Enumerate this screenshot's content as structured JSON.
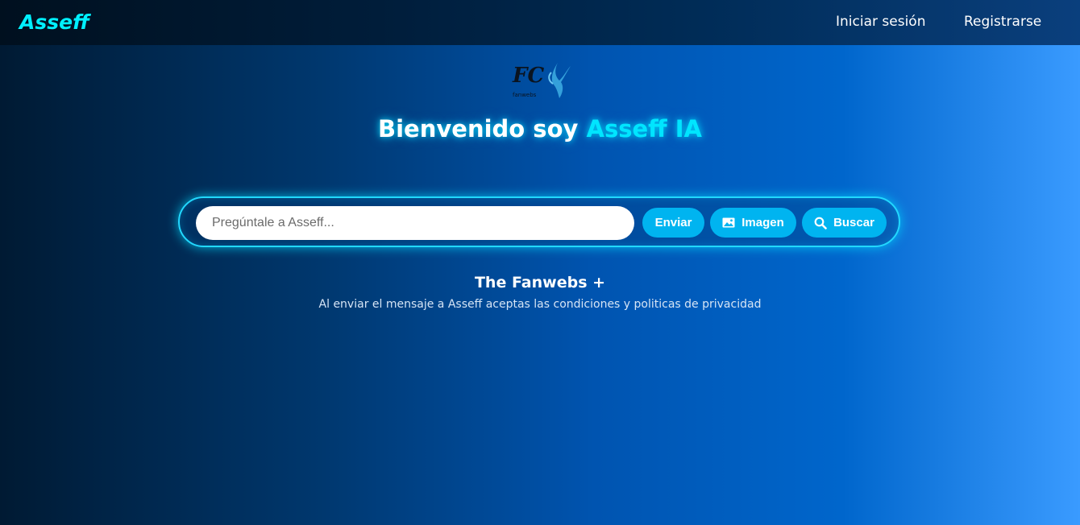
{
  "nav": {
    "brand": "Asseff",
    "links": [
      {
        "label": "Iniciar sesión"
      },
      {
        "label": "Registrarse"
      }
    ]
  },
  "logo": {
    "text": "FC",
    "subtext": "fanwebs"
  },
  "hero": {
    "title_prefix": "Bienvenido soy ",
    "title_accent": "Asseff IA"
  },
  "chat": {
    "placeholder": "Pregúntale a Asseff...",
    "value": "",
    "buttons": {
      "send": "Enviar",
      "image": "Imagen",
      "search": "Buscar"
    }
  },
  "footer": {
    "title": "The Fanwebs +",
    "note": "Al enviar el mensaje a Asseff aceptas las condiciones y politicas de privacidad"
  },
  "colors": {
    "accent": "#00e5ff",
    "button": "#00b4f0",
    "glow_border": "#22d8ff"
  },
  "icons": {
    "image_button": "image-icon",
    "search_button": "search-icon"
  }
}
